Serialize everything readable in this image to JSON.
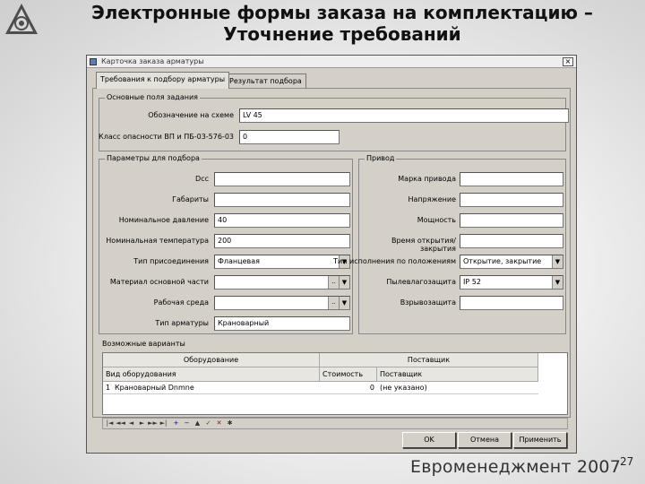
{
  "slide": {
    "title_line1": "Электронные формы заказа на комплектацию –",
    "title_line2": "Уточнение требований",
    "footer": "Евроменеджмент 2007",
    "page_number": "27"
  },
  "window": {
    "title": "Карточка заказа арматуры",
    "close_symbol": "×"
  },
  "tabs": [
    {
      "label": "Требования к подбору арматуры",
      "active": true
    },
    {
      "label": "Результат подбора",
      "active": false
    }
  ],
  "basic": {
    "group_label": "Основные поля задания",
    "fields": [
      {
        "label": "Обозначение на схеме",
        "value": "LV 45"
      },
      {
        "label": "Класс опасности ВП и ПБ-03-576-03",
        "value": "0"
      }
    ]
  },
  "params": {
    "group_label": "Параметры для подбора",
    "fields": [
      {
        "label": "Dcc",
        "value": ""
      },
      {
        "label": "Габариты",
        "value": ""
      },
      {
        "label": "Номинальное давление",
        "value": "40"
      },
      {
        "label": "Номинальная температура",
        "value": "200"
      },
      {
        "label": "Тип присоединения",
        "value": "Фланцевая"
      },
      {
        "label": "Материал основной части",
        "value": ""
      },
      {
        "label": "Рабочая среда",
        "value": ""
      },
      {
        "label": "Тип арматуры",
        "value": "Крановарный"
      }
    ]
  },
  "drive": {
    "group_label": "Привод",
    "fields": [
      {
        "label": "Марка привода",
        "value": ""
      },
      {
        "label": "Напряжение",
        "value": ""
      },
      {
        "label": "Мощность",
        "value": ""
      },
      {
        "label": "Время открытия/закрытия",
        "value": ""
      },
      {
        "label": "Тип исполнения по положениям",
        "value": "Открытие, закрытие"
      },
      {
        "label": "Пылевлагозащита",
        "value": "IP 52"
      },
      {
        "label": "Взрывозащита",
        "value": ""
      }
    ]
  },
  "variants": {
    "group_label": "Возможные варианты",
    "header_equipment": "Оборудование",
    "header_supplier": "Поставщик",
    "col_name": "Вид оборудования",
    "col_cost": "Стоимость",
    "col_supplier": "Поставщик",
    "rows": [
      {
        "num": "1",
        "name": "Крановарный Dnmne",
        "cost": "0",
        "supplier": "(не указано)"
      }
    ]
  },
  "navbar": [
    "|◄",
    "◄◄",
    "◄",
    "►",
    "►►",
    "►|",
    "+",
    "−",
    "▲",
    "✓",
    "✕",
    "✱"
  ],
  "buttons": {
    "ok": "OK",
    "cancel": "Отмена",
    "apply": "Применить"
  },
  "colors": {
    "dialog_bg": "#d4d0c8",
    "field_bg": "#ffffff"
  }
}
